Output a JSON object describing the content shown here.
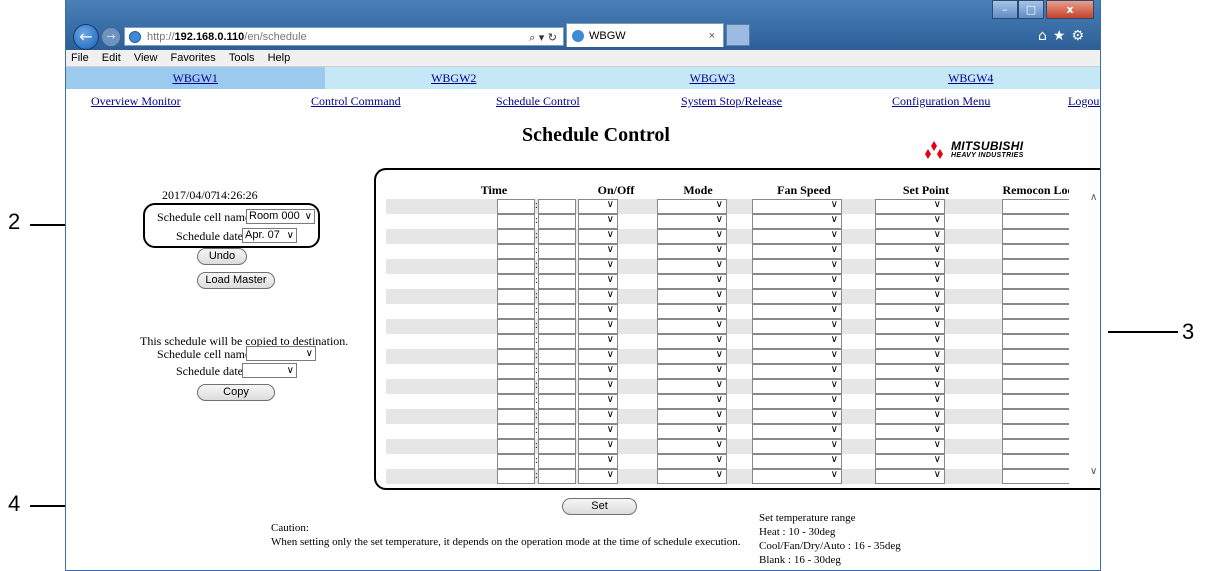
{
  "browser": {
    "url_prefix": "http://",
    "url_host": "192.168.0.110",
    "url_path": "/en/schedule",
    "address_tools": "⌕ ▾ ↻",
    "tab_title": "WBGW",
    "tab_close": "×",
    "window_controls": {
      "minimize": "–",
      "maximize": "□",
      "close": "x"
    },
    "toolbar_icons": "⌂★⚙",
    "menu": [
      "File",
      "Edit",
      "View",
      "Favorites",
      "Tools",
      "Help"
    ]
  },
  "gateways": [
    "WBGW1",
    "WBGW2",
    "WBGW3",
    "WBGW4"
  ],
  "nav": {
    "overview": "Overview Monitor",
    "control": "Control Command",
    "schedule": "Schedule Control",
    "system": "System Stop/Release",
    "config": "Configuration Menu",
    "logout": "Logout"
  },
  "page_title": "Schedule Control",
  "logo": {
    "name": "MITSUBISHI",
    "sub": "HEAVY INDUSTRIES"
  },
  "left": {
    "date": "2017/04/07",
    "time": "14:26:26",
    "cell_name_label": "Schedule cell name:",
    "cell_name_value": "Room 000",
    "date_label": "Schedule date:",
    "date_value": "Apr. 07",
    "undo": "Undo",
    "load_master": "Load Master",
    "copy_note": "This schedule will be copied to destination.",
    "dest_cell_label": "Schedule cell name:",
    "dest_date_label": "Schedule date:",
    "copy": "Copy"
  },
  "table": {
    "headers": {
      "time": "Time",
      "onoff": "On/Off",
      "mode": "Mode",
      "fan": "Fan Speed",
      "setpoint": "Set Point",
      "lock": "Remocon Lock"
    },
    "row_count": 19
  },
  "set_button": "Set",
  "caution": {
    "title": "Caution:",
    "text": "When setting only the set temperature, it depends on the operation mode at the time of schedule execution."
  },
  "temp_range": {
    "title": "Set temperature range",
    "heat": "Heat : 10 - 30deg",
    "cool": "Cool/Fan/Dry/Auto : 16 - 35deg",
    "blank": "Blank : 16 - 30deg"
  },
  "callouts": [
    "2",
    "3",
    "4"
  ],
  "scroll_arrows": {
    "up": "∧",
    "down": "∨"
  }
}
